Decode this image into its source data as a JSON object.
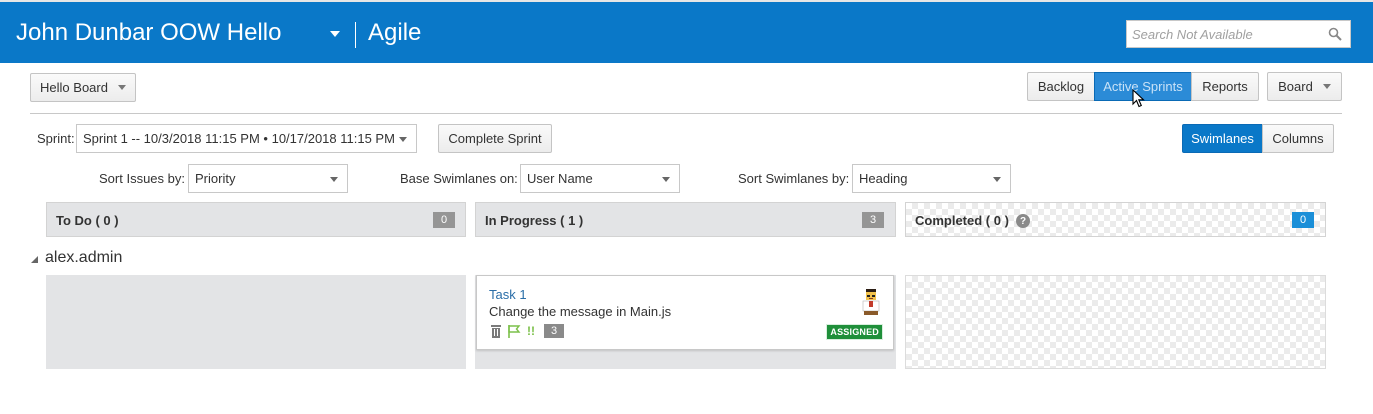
{
  "header": {
    "project_title": "John Dunbar OOW Hello",
    "app_title": "Agile",
    "search_placeholder": "Search Not Available"
  },
  "toolbar": {
    "board_dropdown": "Hello Board",
    "views": [
      "Backlog",
      "Active Sprints",
      "Reports"
    ],
    "active_view": "Active Sprints",
    "board_menu": "Board"
  },
  "sprint_bar": {
    "sprint_label": "Sprint:",
    "sprint_value": "Sprint 1 -- 10/3/2018 11:15 PM • 10/17/2018 11:15 PM",
    "complete_button": "Complete Sprint",
    "layout_toggle": [
      "Swimlanes",
      "Columns"
    ],
    "active_layout": "Swimlanes"
  },
  "filters": {
    "sort_issues_label": "Sort Issues by:",
    "sort_issues_value": "Priority",
    "base_swimlanes_label": "Base Swimlanes on:",
    "base_swimlanes_value": "User Name",
    "sort_swimlanes_label": "Sort Swimlanes by:",
    "sort_swimlanes_value": "Heading"
  },
  "columns": [
    {
      "title": "To Do ( 0 )",
      "badge": "0"
    },
    {
      "title": "In Progress ( 1 )",
      "badge": "3"
    },
    {
      "title": "Completed ( 0 )",
      "badge": "0"
    }
  ],
  "swimlane": {
    "name": "alex.admin",
    "card": {
      "title": "Task 1",
      "summary": "Change the message in Main.js",
      "points": "3",
      "priority_mark": "!!",
      "status": "ASSIGNED"
    }
  },
  "icons": [
    "search-icon",
    "chevron-down-icon",
    "collapse-triangle-icon",
    "help-icon",
    "trash-icon",
    "flag-icon",
    "avatar-icon",
    "mouse-cursor-icon"
  ],
  "colors": {
    "header_bg": "#0a78c8",
    "accent": "#0a78c8",
    "status_assigned": "#1f8f3a",
    "column_bg": "#e3e4e6",
    "badge_blue": "#1b8fd8"
  }
}
